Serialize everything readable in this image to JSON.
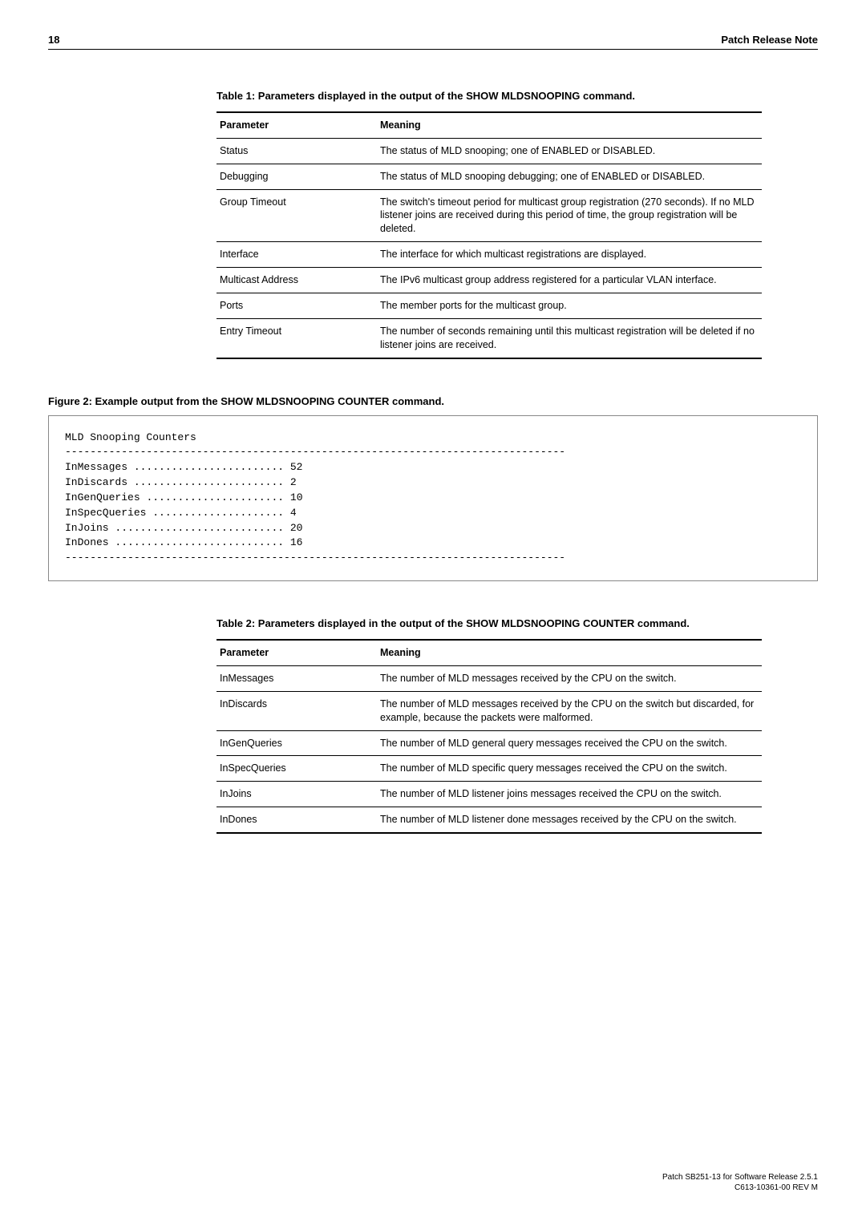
{
  "header": {
    "page_number": "18",
    "title": "Patch Release Note"
  },
  "table1": {
    "caption": "Table 1: Parameters displayed in the output of the SHOW MLDSNOOPING command.",
    "columns": [
      "Parameter",
      "Meaning"
    ],
    "rows": [
      {
        "param": "Status",
        "meaning": "The status of MLD snooping; one of ENABLED or DISABLED."
      },
      {
        "param": "Debugging",
        "meaning": "The status of MLD snooping debugging; one of ENABLED or DISABLED."
      },
      {
        "param": "Group Timeout",
        "meaning": "The switch's timeout period for multicast group registration (270 seconds). If no MLD listener joins are received during this period of time, the group registration will be deleted."
      },
      {
        "param": "Interface",
        "meaning": "The interface for which multicast registrations are displayed."
      },
      {
        "param": "Multicast Address",
        "meaning": "The IPv6 multicast group address registered for a particular VLAN interface."
      },
      {
        "param": "Ports",
        "meaning": "The member ports for the multicast group."
      },
      {
        "param": "Entry Timeout",
        "meaning": "The number of seconds remaining until this multicast registration will be deleted if no listener joins are received."
      }
    ]
  },
  "figure2": {
    "caption": "Figure 2: Example output from the SHOW MLDSNOOPING COUNTER command.",
    "line_title": "MLD Snooping Counters",
    "dashes": "--------------------------------------------------------------------------------",
    "rows": [
      {
        "label": "InMessages",
        "dots": "........................",
        "value": "52"
      },
      {
        "label": "InDiscards",
        "dots": "........................",
        "value": "2"
      },
      {
        "label": "InGenQueries",
        "dots": "......................",
        "value": "10"
      },
      {
        "label": "InSpecQueries",
        "dots": ".....................",
        "value": "4"
      },
      {
        "label": "InJoins",
        "dots": "...........................",
        "value": "20"
      },
      {
        "label": "InDones",
        "dots": "...........................",
        "value": "16"
      }
    ]
  },
  "table2": {
    "caption": "Table 2: Parameters displayed in the output of the SHOW MLDSNOOPING COUNTER command.",
    "columns": [
      "Parameter",
      "Meaning"
    ],
    "rows": [
      {
        "param": "InMessages",
        "meaning": "The number of MLD messages received by the CPU on the switch."
      },
      {
        "param": "InDiscards",
        "meaning": "The number of MLD messages received by the CPU on the switch but discarded, for example, because the packets were malformed."
      },
      {
        "param": "InGenQueries",
        "meaning": "The number of MLD general query messages received the CPU on the switch."
      },
      {
        "param": "InSpecQueries",
        "meaning": "The number of MLD specific query messages received the CPU on the switch."
      },
      {
        "param": "InJoins",
        "meaning": "The number of MLD listener joins messages received the CPU on the switch."
      },
      {
        "param": "InDones",
        "meaning": "The number of MLD listener done messages received by the CPU on the switch."
      }
    ]
  },
  "footer": {
    "line1": "Patch SB251-13 for Software Release 2.5.1",
    "line2": "C613-10361-00 REV M"
  }
}
